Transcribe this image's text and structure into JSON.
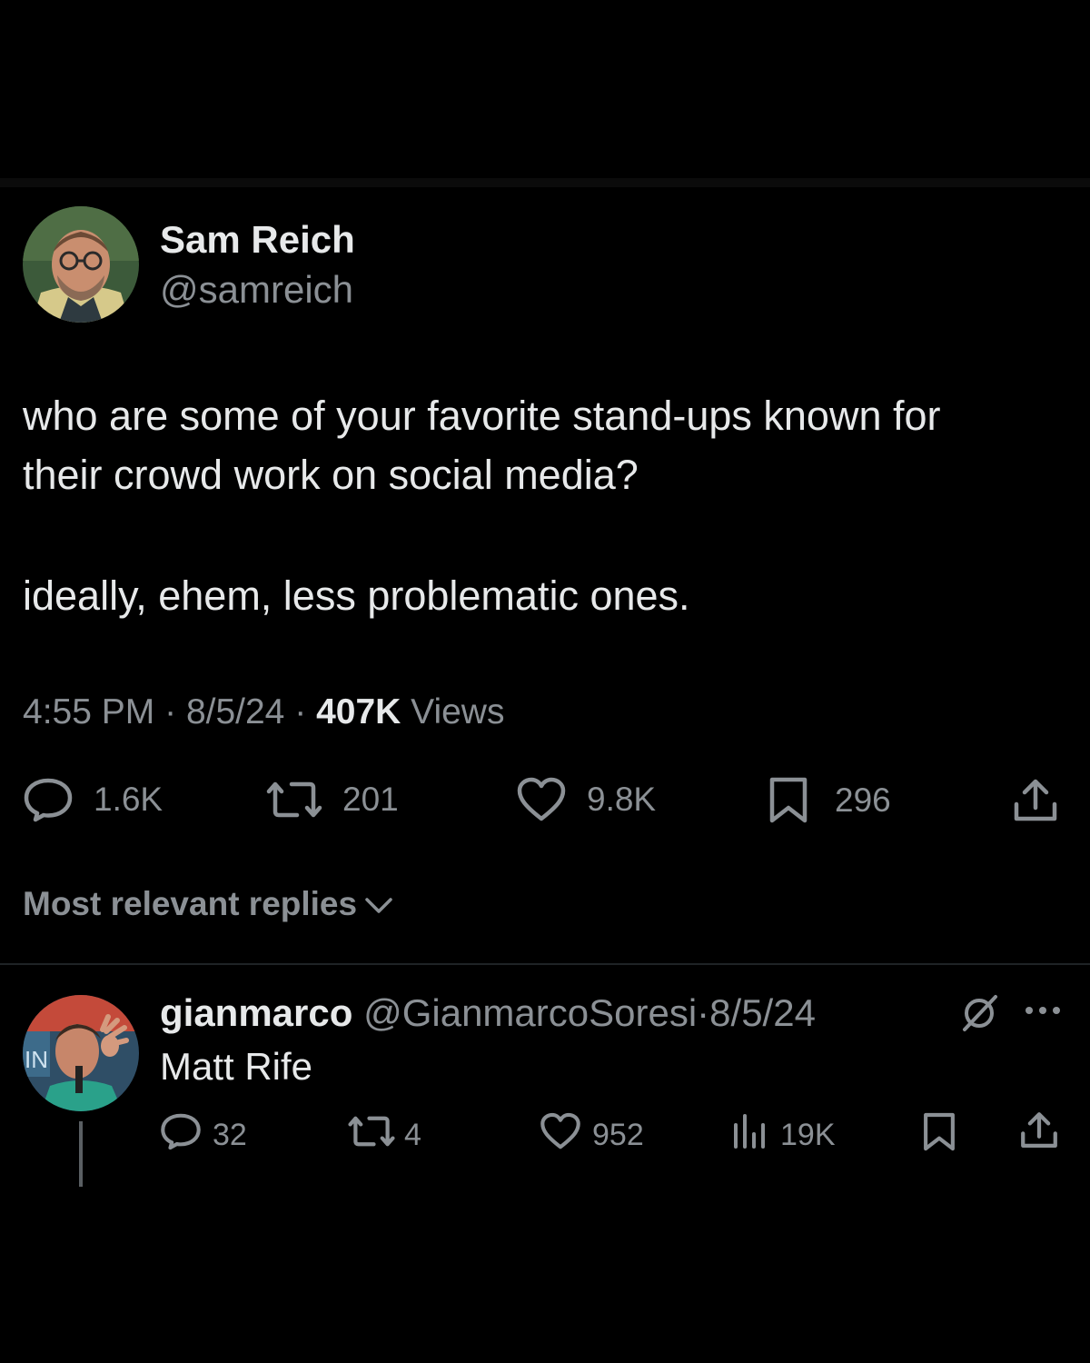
{
  "tweet": {
    "author_name": "Sam Reich",
    "author_handle": "@samreich",
    "text_line1": "who are some of your favorite stand-ups known for",
    "text_line2": "their crowd work on social media?",
    "text_line3": "ideally, ehem, less problematic ones.",
    "time": "4:55 PM",
    "date": "8/5/24",
    "views_count": "407K",
    "views_label": "Views",
    "sep": "·",
    "stats": {
      "replies": "1.6K",
      "reposts": "201",
      "likes": "9.8K",
      "bookmarks": "296"
    }
  },
  "sort_label": "Most relevant replies",
  "reply": {
    "author_name": "gianmarco",
    "author_handle": "@GianmarcoSoresi",
    "date": "8/5/24",
    "sep": "·",
    "text": "Matt Rife",
    "stats": {
      "replies": "32",
      "reposts": "4",
      "likes": "952",
      "views": "19K"
    }
  },
  "icons": [
    "reply-icon",
    "repost-icon",
    "like-icon",
    "bookmark-icon",
    "share-icon",
    "views-icon",
    "grok-icon",
    "more-icon",
    "chevron-down-icon"
  ]
}
